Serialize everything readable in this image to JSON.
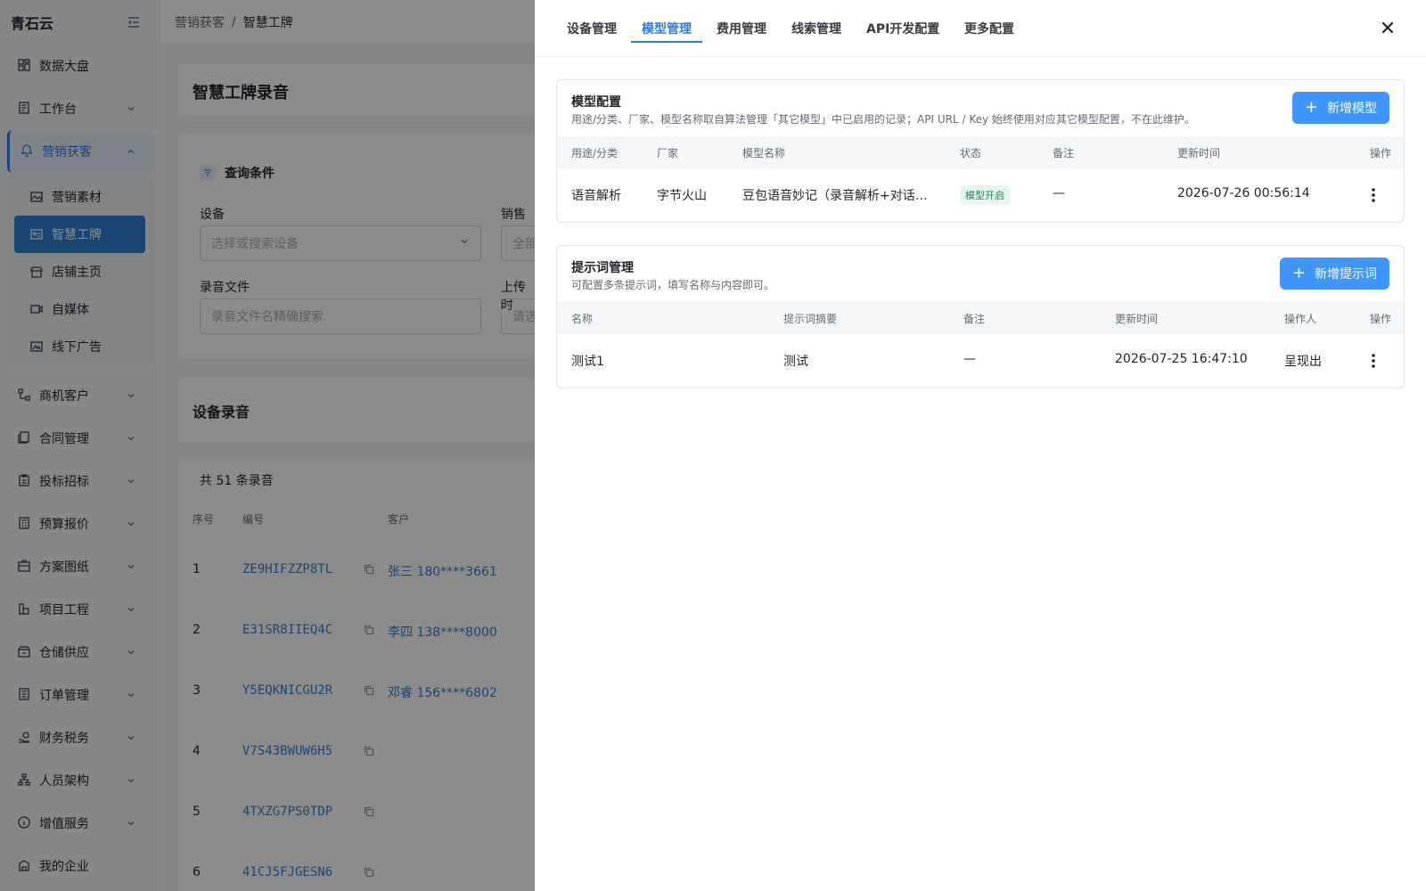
{
  "app": {
    "name": "青石云"
  },
  "sidebar": {
    "items": [
      {
        "label": "数据大盘",
        "icon": "dashboard-icon"
      },
      {
        "label": "工作台",
        "icon": "workbench-icon"
      },
      {
        "label": "营销获客",
        "icon": "marketing-icon"
      },
      {
        "label": "商机客户",
        "icon": "opportunity-icon"
      },
      {
        "label": "合同管理",
        "icon": "contract-icon"
      },
      {
        "label": "投标招标",
        "icon": "bidding-icon"
      },
      {
        "label": "预算报价",
        "icon": "budget-icon"
      },
      {
        "label": "方案图纸",
        "icon": "blueprint-icon"
      },
      {
        "label": "项目工程",
        "icon": "project-icon"
      },
      {
        "label": "仓储供应",
        "icon": "warehouse-icon"
      },
      {
        "label": "订单管理",
        "icon": "order-icon"
      },
      {
        "label": "财务税务",
        "icon": "finance-icon"
      },
      {
        "label": "人员架构",
        "icon": "org-icon"
      },
      {
        "label": "增值服务",
        "icon": "info-icon"
      },
      {
        "label": "我的企业",
        "icon": "enterprise-icon"
      }
    ],
    "sub_items": [
      {
        "label": "营销素材",
        "icon": "image-icon"
      },
      {
        "label": "智慧工牌",
        "icon": "badge-card-icon"
      },
      {
        "label": "店铺主页",
        "icon": "shop-icon"
      },
      {
        "label": "自媒体",
        "icon": "video-icon"
      },
      {
        "label": "线下广告",
        "icon": "ad-icon"
      }
    ]
  },
  "breadcrumb": {
    "parent": "营销获客",
    "separator": "/",
    "current": "智慧工牌"
  },
  "page": {
    "title": "智慧工牌录音",
    "query": {
      "title": "查询条件",
      "device_label": "设备",
      "device_placeholder": "选择或搜索设备",
      "sales_label": "销售",
      "sales_value": "全部",
      "file_label": "录音文件",
      "file_placeholder": "录音文件名精确搜索",
      "upload_label": "上传时",
      "upload_placeholder": "请选"
    },
    "recordings": {
      "title": "设备录音",
      "count_text": "共 51 条录音",
      "columns": [
        "序号",
        "编号",
        "客户"
      ],
      "rows": [
        {
          "no": "1",
          "code": "ZE9HIFZZP8TL",
          "customer": "张三 180****3661"
        },
        {
          "no": "2",
          "code": "E31SR8IIEQ4C",
          "customer": "李四 138****8000"
        },
        {
          "no": "3",
          "code": "Y5EQKNICGU2R",
          "customer": "邓睿 156****6802"
        },
        {
          "no": "4",
          "code": "V7S43BWUW6H5",
          "customer": ""
        },
        {
          "no": "5",
          "code": "4TXZG7PS0TDP",
          "customer": ""
        },
        {
          "no": "6",
          "code": "41CJ5FJGESN6",
          "customer": ""
        }
      ]
    }
  },
  "drawer": {
    "tabs": [
      "设备管理",
      "模型管理",
      "费用管理",
      "线索管理",
      "API开发配置",
      "更多配置"
    ],
    "active_tab": "模型管理",
    "model_config": {
      "title": "模型配置",
      "subtitle": "用途/分类、厂家、模型名称取自算法管理「其它模型」中已启用的记录；API URL / Key 始终使用对应其它模型配置，不在此维护。",
      "add_button": "新增模型",
      "columns": [
        "用途/分类",
        "厂家",
        "模型名称",
        "状态",
        "备注",
        "更新时间",
        "操作"
      ],
      "rows": [
        {
          "purpose": "语音解析",
          "vendor": "字节火山",
          "model": "豆包语音妙记（录音解析+对话…",
          "status": "模型开启",
          "note": "—",
          "updated": "2026-07-26 00:56:14"
        }
      ]
    },
    "prompt_mgmt": {
      "title": "提示词管理",
      "subtitle": "可配置多条提示词，填写名称与内容即可。",
      "add_button": "新增提示词",
      "columns": [
        "名称",
        "提示词摘要",
        "备注",
        "更新时间",
        "操作人",
        "操作"
      ],
      "rows": [
        {
          "name": "测试1",
          "summary": "测试",
          "note": "—",
          "updated": "2026-07-25 16:47:10",
          "operator": "呈现出"
        }
      ]
    }
  },
  "colors": {
    "accent": "#2f7fd4",
    "button": "#4096ff",
    "status_green": "#1b8a52"
  }
}
